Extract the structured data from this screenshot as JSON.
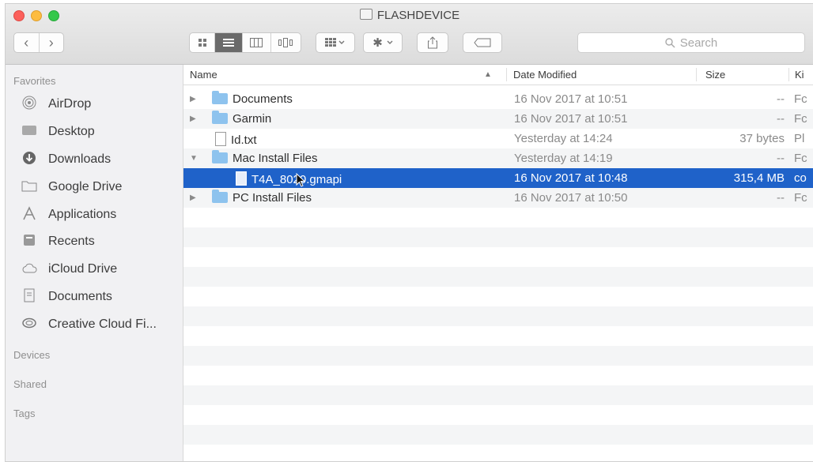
{
  "window": {
    "title": "FLASHDEVICE"
  },
  "toolbar": {
    "back_glyph": "‹",
    "forward_glyph": "›",
    "view_icons": [
      "icon-view-icon",
      "list-view-icon",
      "column-view-icon",
      "cover-flow-icon"
    ],
    "search_placeholder": "Search"
  },
  "sidebar": {
    "favorites_header": "Favorites",
    "items": [
      {
        "label": "AirDrop",
        "icon": "airdrop-icon"
      },
      {
        "label": "Desktop",
        "icon": "desktop-icon"
      },
      {
        "label": "Downloads",
        "icon": "downloads-icon"
      },
      {
        "label": "Google Drive",
        "icon": "folder-icon"
      },
      {
        "label": "Applications",
        "icon": "applications-icon"
      },
      {
        "label": "Recents",
        "icon": "recents-icon"
      },
      {
        "label": "iCloud Drive",
        "icon": "cloud-icon"
      },
      {
        "label": "Documents",
        "icon": "documents-icon"
      },
      {
        "label": "Creative Cloud Fi...",
        "icon": "creative-cloud-icon"
      }
    ],
    "devices_header": "Devices",
    "shared_header": "Shared",
    "tags_header": "Tags"
  },
  "columns": {
    "name": "Name",
    "date": "Date Modified",
    "size": "Size",
    "kind": "Ki"
  },
  "files": [
    {
      "name": "Documents",
      "date": "16 Nov 2017 at 10:51",
      "size": "--",
      "kind": "Fc",
      "type": "folder",
      "disclosure": "▶",
      "selected": false
    },
    {
      "name": "Garmin",
      "date": "16 Nov 2017 at 10:51",
      "size": "--",
      "kind": "Fc",
      "type": "folder",
      "disclosure": "▶",
      "selected": false
    },
    {
      "name": "Id.txt",
      "date": "Yesterday at 14:24",
      "size": "37 bytes",
      "kind": "Pl",
      "type": "doc",
      "disclosure": "",
      "selected": false
    },
    {
      "name": "Mac Install Files",
      "date": "Yesterday at 14:19",
      "size": "--",
      "kind": "Fc",
      "type": "folder",
      "disclosure": "▼",
      "selected": false
    },
    {
      "name": "T4A_8020.gmapi",
      "date": "16 Nov 2017 at 10:48",
      "size": "315,4 MB",
      "kind": "co",
      "type": "doc",
      "disclosure": "",
      "selected": true
    },
    {
      "name": "PC Install Files",
      "date": "16 Nov 2017 at 10:50",
      "size": "--",
      "kind": "Fc",
      "type": "folder",
      "disclosure": "▶",
      "selected": false
    }
  ]
}
